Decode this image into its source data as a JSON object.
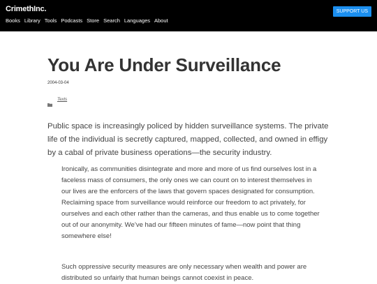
{
  "header": {
    "logo": "CrimethInc.",
    "nav": [
      "Books",
      "Library",
      "Tools",
      "Podcasts",
      "Store",
      "Search",
      "Languages",
      "About"
    ],
    "support_label": "SUPPORT US"
  },
  "article": {
    "title": "You Are Under Surveillance",
    "date": "2004-03-04",
    "category_icon": "folder-icon",
    "category": "Texts",
    "lead": "Public space is increasingly policed by hidden surveillance systems. The private life of the individual is secretly captured, mapped, collected, and owned in effigy by a cabal of private business operations—the security industry.",
    "quotes": [
      "Ironically, as communities disintegrate and more and more of us find ourselves lost in a faceless mass of consumers, the only ones we can count on to interest themselves in our lives are the enforcers of the laws that govern spaces designated for consumption. Reclaiming space from surveillance would reinforce our freedom to act privately, for ourselves and each other rather than the cameras, and thus enable us to come together out of our anonymity. We’ve had our fifteen minutes of fame—now point that thing somewhere else!",
      "Such oppressive security measures are only necessary when wealth and power are distributed so unfairly that human beings cannot coexist in peace."
    ]
  },
  "colors": {
    "header_bg": "#000000",
    "accent": "#1b8ff0",
    "text": "#333333"
  }
}
